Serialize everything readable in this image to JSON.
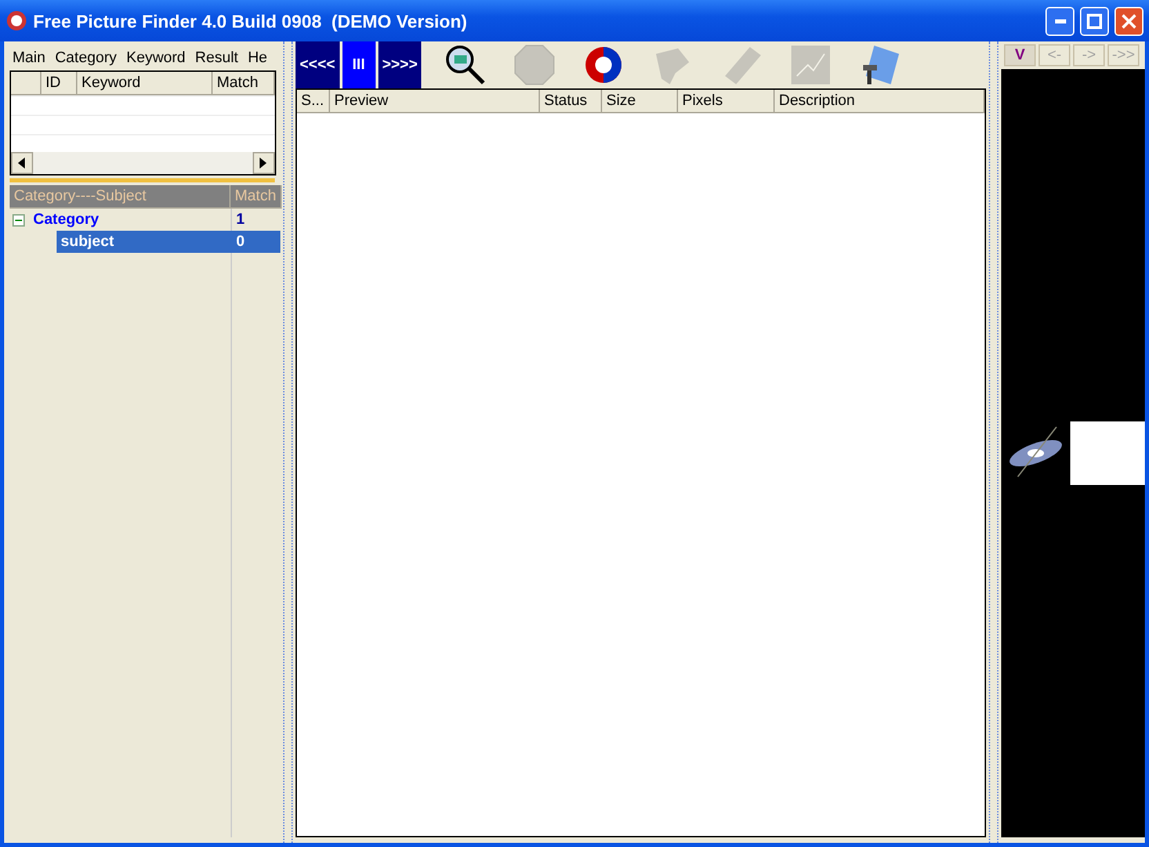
{
  "window": {
    "title": "Free Picture Finder 4.0 Build 0908  (DEMO Version)"
  },
  "menu": [
    "Main",
    "Category",
    "Keyword",
    "Result",
    "He"
  ],
  "keyword_table": {
    "columns": [
      "ID",
      "Keyword",
      "Match"
    ]
  },
  "tree": {
    "columns": [
      "Category----Subject",
      "Match"
    ],
    "items": [
      {
        "label": "Category",
        "match": "1",
        "expanded": true,
        "selected": false,
        "children": [
          {
            "label": "subject",
            "match": "0",
            "selected": true
          }
        ]
      }
    ]
  },
  "nav_buttons": [
    {
      "label": "<<<<",
      "selected": false
    },
    {
      "label": "III",
      "selected": true
    },
    {
      "label": ">>>>",
      "selected": false
    }
  ],
  "toolbar": [
    {
      "kind": "search",
      "disabled": false
    },
    {
      "kind": "stop",
      "disabled": true
    },
    {
      "kind": "refresh",
      "disabled": false
    },
    {
      "kind": "tools",
      "disabled": true
    },
    {
      "kind": "tag",
      "disabled": true
    },
    {
      "kind": "network",
      "disabled": true
    },
    {
      "kind": "settings",
      "disabled": false
    }
  ],
  "results_table": {
    "columns": [
      "S...",
      "Preview",
      "Status",
      "Size",
      "Pixels",
      "Description"
    ]
  },
  "right_tabs": [
    {
      "label": "V",
      "selected": true
    },
    {
      "label": "<-",
      "selected": false
    },
    {
      "label": "->",
      "selected": false
    },
    {
      "label": "->>",
      "selected": false
    }
  ],
  "preview": {
    "kind": "picture"
  }
}
